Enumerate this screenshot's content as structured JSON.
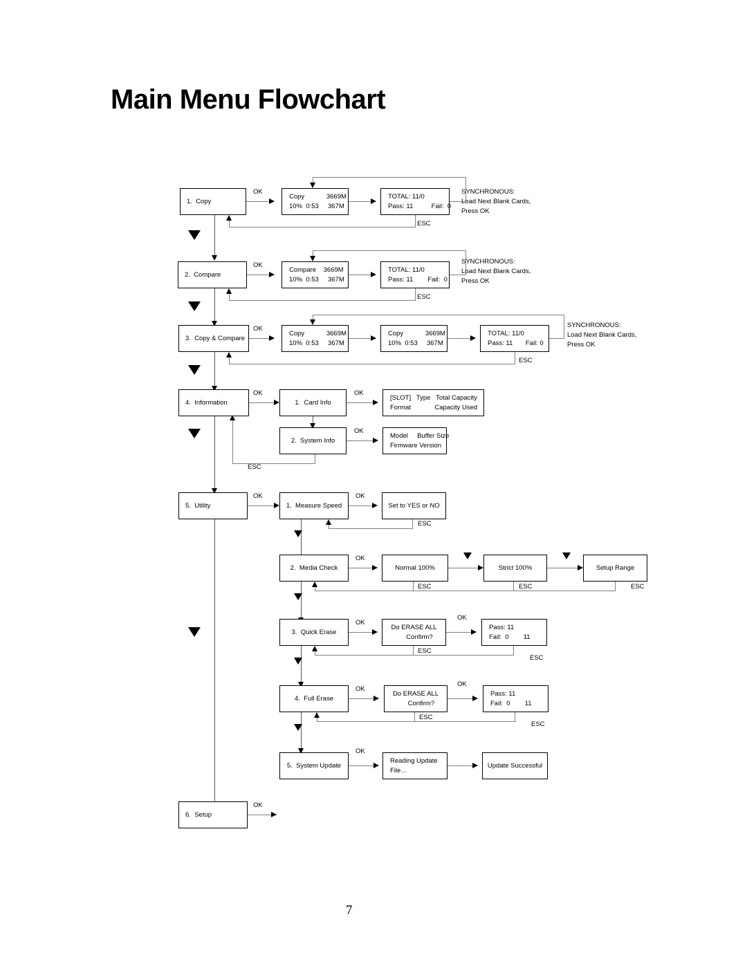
{
  "document": {
    "title": "Main Menu Flowchart",
    "page_number": "7"
  },
  "labels": {
    "ok": "OK",
    "esc": "ESC"
  },
  "notes": {
    "synchronous": "SYNCHRONOUS:\nLoad Next Blank Cards,\nPress OK"
  },
  "rows": {
    "copy": {
      "menu": "1.  Copy",
      "progress_l1": "Copy            3669M",
      "progress_l2": "10%  0:53     367M",
      "result_l1": "TOTAL: 11/0",
      "result_l2": "Pass: 11          Fail:  0"
    },
    "compare": {
      "menu": "2.  Compare",
      "progress_l1": "Compare    3669M",
      "progress_l2": "10%  0:53     367M",
      "result_l1": "TOTAL: 11/0",
      "result_l2": "Pass: 11        Fail:  0"
    },
    "copy_compare": {
      "menu": "3.  Copy & Compare",
      "progress1_l1": "Copy            3669M",
      "progress1_l2": "10%  0:53     367M",
      "progress2_l1": "Copy            3669M",
      "progress2_l2": "10%  0:53     367M",
      "result_l1": "TOTAL: 11/0",
      "result_l2": "Pass: 11       Fail: 0"
    },
    "information": {
      "menu": "4.  Information",
      "card_info": "1.  Card Info",
      "card_info_detail_l1": "[SLOT]   Type   Total Capacity",
      "card_info_detail_l2": "Format             Capacity Used",
      "system_info": "2.  System Info",
      "system_info_detail_l1": "Model     Buffer Size",
      "system_info_detail_l2": "Firmware Version"
    },
    "utility": {
      "menu": "5.  Utility",
      "measure_speed": "1.  Measure Speed",
      "measure_speed_result": "Set to YES or NO",
      "media_check": "2.  Media Check",
      "media_normal": "Normal 100%",
      "media_strict": "Strict 100%",
      "media_setup_range": "Setup Range",
      "quick_erase": "3.  Quick Erase",
      "quick_erase_confirm_l1": "Do ERASE ALL",
      "quick_erase_confirm_l2": "      Confirm?",
      "quick_erase_result_l1": "Pass: 11",
      "quick_erase_result_l2": "Fail:  0        11",
      "full_erase": "4.  Full Erase",
      "full_erase_confirm_l1": "Do ERASE ALL",
      "full_erase_confirm_l2": "      Confirm?",
      "full_erase_result_l1": "Pass: 11",
      "full_erase_result_l2": "Fail:  0        11",
      "system_update": "5.  System Update",
      "system_update_reading_l1": "Reading Update",
      "system_update_reading_l2": "File…",
      "system_update_success": "Update Successful"
    },
    "setup": {
      "menu": "6.  Setup"
    }
  }
}
